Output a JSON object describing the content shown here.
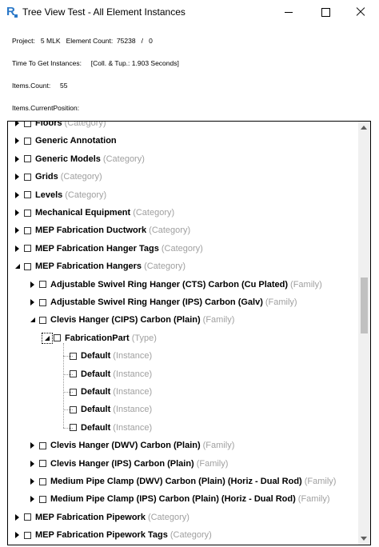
{
  "window": {
    "title": "Tree View Test - All Element Instances",
    "icon": "revit-icon"
  },
  "info": {
    "project_label": "Project:",
    "project_value": "5 MLK",
    "count_label": "Element Count:",
    "count_value": "75238",
    "count_sep": "/",
    "count_selected": "0",
    "time_label": "Time To Get Instances:",
    "time_value": "[Coll. & Tup.: 1.903 Seconds]",
    "items_count_label": "Items.Count:",
    "items_count_value": "55",
    "current_position_label": "Items.CurrentPosition:"
  },
  "tree": {
    "rows": [
      {
        "label": "Floors",
        "kind": "(Category)",
        "level": 0,
        "expander": "collapsed"
      },
      {
        "label": "Generic Annotation",
        "kind": "",
        "level": 0,
        "expander": "collapsed"
      },
      {
        "label": "Generic Models",
        "kind": "(Category)",
        "level": 0,
        "expander": "collapsed"
      },
      {
        "label": "Grids",
        "kind": "(Category)",
        "level": 0,
        "expander": "collapsed"
      },
      {
        "label": "Levels",
        "kind": "(Category)",
        "level": 0,
        "expander": "collapsed"
      },
      {
        "label": "Mechanical Equipment",
        "kind": "(Category)",
        "level": 0,
        "expander": "collapsed"
      },
      {
        "label": "MEP Fabrication Ductwork",
        "kind": "(Category)",
        "level": 0,
        "expander": "collapsed"
      },
      {
        "label": "MEP Fabrication Hanger Tags",
        "kind": "(Category)",
        "level": 0,
        "expander": "collapsed"
      },
      {
        "label": "MEP Fabrication Hangers",
        "kind": "(Category)",
        "level": 0,
        "expander": "expanded"
      },
      {
        "label": "Adjustable Swivel Ring Hanger (CTS) Carbon (Cu Plated)",
        "kind": "(Family)",
        "level": 1,
        "expander": "collapsed"
      },
      {
        "label": "Adjustable Swivel Ring Hanger (IPS) Carbon (Galv)",
        "kind": "(Family)",
        "level": 1,
        "expander": "collapsed"
      },
      {
        "label": "Clevis Hanger (CIPS) Carbon (Plain)",
        "kind": "(Family)",
        "level": 1,
        "expander": "expanded"
      },
      {
        "label": "FabricationPart",
        "kind": "(Type)",
        "level": 2,
        "expander": "focus"
      },
      {
        "label": "Default",
        "kind": "(Instance)",
        "level": 3,
        "expander": "none"
      },
      {
        "label": "Default",
        "kind": "(Instance)",
        "level": 3,
        "expander": "none"
      },
      {
        "label": "Default",
        "kind": "(Instance)",
        "level": 3,
        "expander": "none"
      },
      {
        "label": "Default",
        "kind": "(Instance)",
        "level": 3,
        "expander": "none"
      },
      {
        "label": "Default",
        "kind": "(Instance)",
        "level": 3,
        "expander": "none"
      },
      {
        "label": "Clevis Hanger (DWV) Carbon (Plain)",
        "kind": "(Family)",
        "level": 1,
        "expander": "collapsed"
      },
      {
        "label": "Clevis Hanger (IPS) Carbon (Plain)",
        "kind": "(Family)",
        "level": 1,
        "expander": "collapsed"
      },
      {
        "label": "Medium Pipe Clamp (DWV) Carbon (Plain) (Horiz - Dual Rod)",
        "kind": "(Family)",
        "level": 1,
        "expander": "collapsed"
      },
      {
        "label": "Medium Pipe Clamp (IPS) Carbon (Plain) (Horiz - Dual Rod)",
        "kind": "(Family)",
        "level": 1,
        "expander": "collapsed"
      },
      {
        "label": "MEP Fabrication Pipework",
        "kind": "(Category)",
        "level": 0,
        "expander": "collapsed"
      },
      {
        "label": "MEP Fabrication Pipework Tags",
        "kind": "(Category)",
        "level": 0,
        "expander": "collapsed"
      }
    ]
  },
  "scrollbar": {
    "position_fraction": 0.42,
    "visible_fraction": 0.14
  }
}
